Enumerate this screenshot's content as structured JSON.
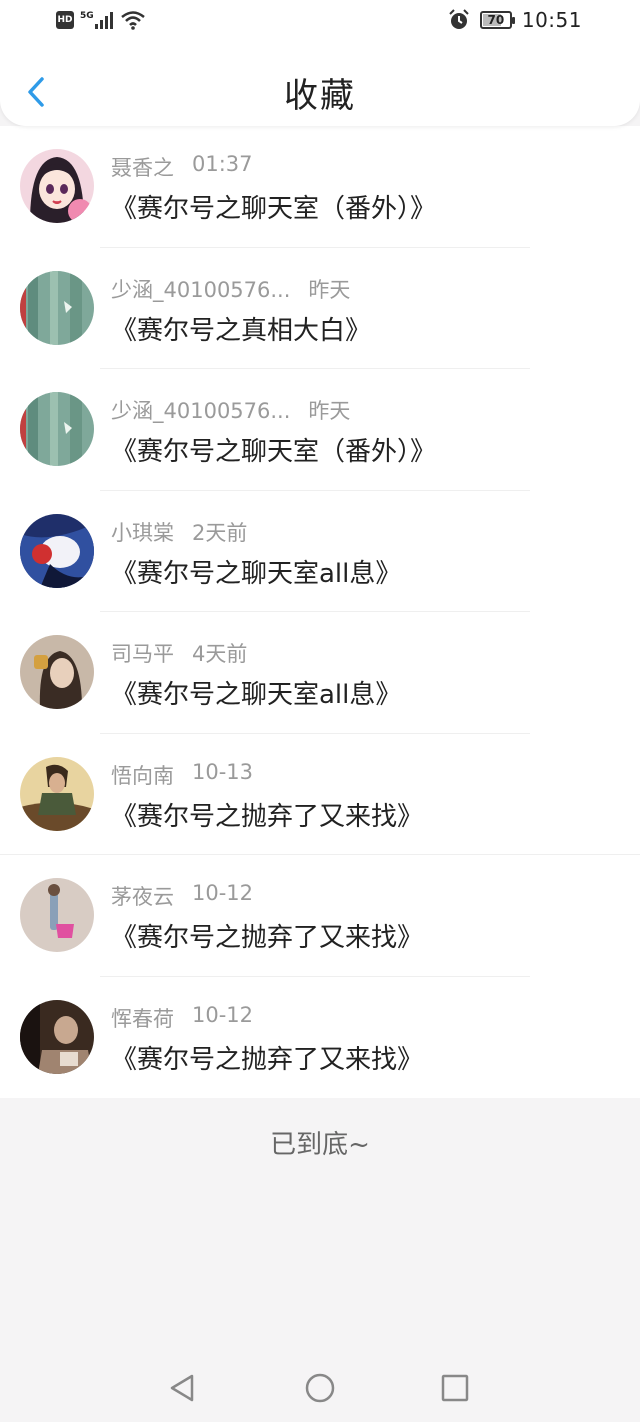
{
  "status_bar": {
    "hd": "HD",
    "network": "5G",
    "battery": "70",
    "battery_level": 0.7,
    "time": "10:51"
  },
  "header": {
    "title": "收藏",
    "back_icon": "chevron-left-icon",
    "accent_color": "#2f9be8"
  },
  "items": [
    {
      "author": "聂香之",
      "time": "01:37",
      "title": "《赛尔号之聊天室（番外）》"
    },
    {
      "author": "少涵_40100576...",
      "time": "昨天",
      "title": "《赛尔号之真相大白》"
    },
    {
      "author": "少涵_40100576...",
      "time": "昨天",
      "title": "《赛尔号之聊天室（番外）》"
    },
    {
      "author": "小琪棠",
      "time": "2天前",
      "title": "《赛尔号之聊天室all息》"
    },
    {
      "author": "司马平",
      "time": "4天前",
      "title": "《赛尔号之聊天室all息》"
    },
    {
      "author": "悟向南",
      "time": "10-13",
      "title": "《赛尔号之抛弃了又来找》"
    },
    {
      "author": "茅夜云",
      "time": "10-12",
      "title": "《赛尔号之抛弃了又来找》"
    },
    {
      "author": "恽春荷",
      "time": "10-12",
      "title": "《赛尔号之抛弃了又来找》"
    }
  ],
  "footer": {
    "end_text": "已到底~"
  },
  "nav_bar": {
    "back": "triangle-back-icon",
    "home": "circle-home-icon",
    "recents": "square-recents-icon"
  }
}
